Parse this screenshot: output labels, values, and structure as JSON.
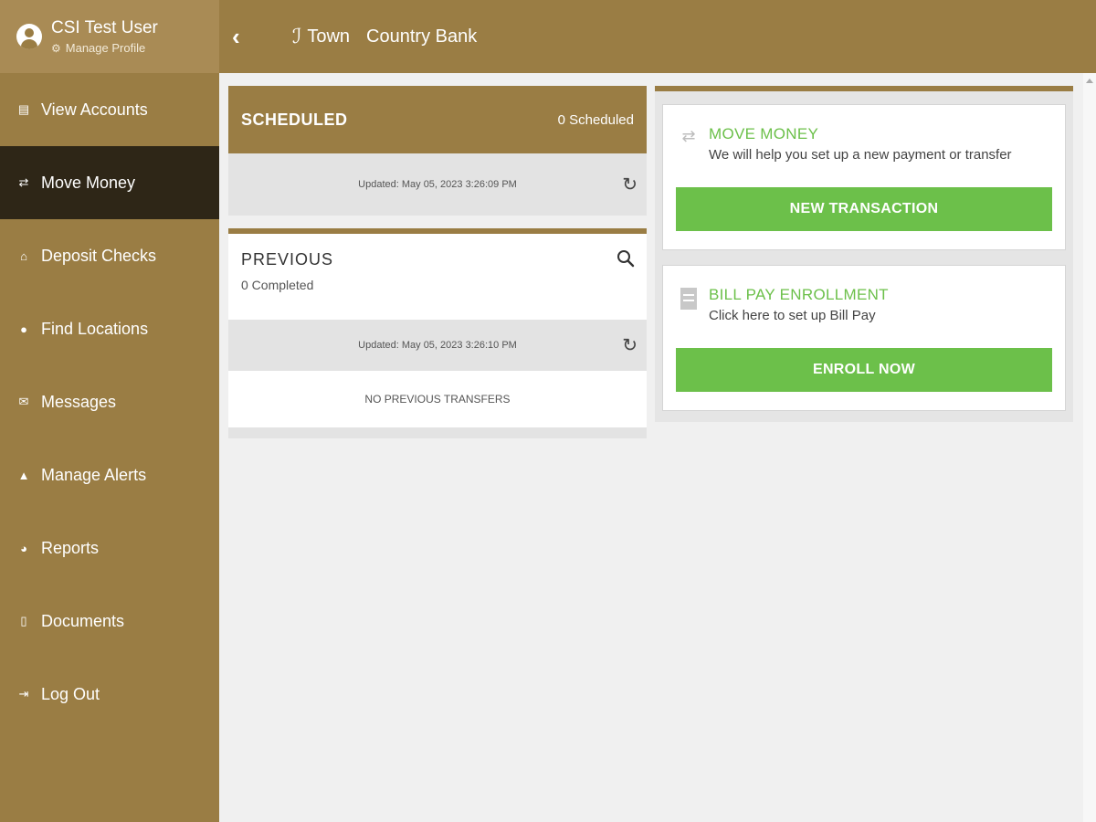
{
  "profile": {
    "name": "CSI Test User",
    "manage_label": "Manage Profile"
  },
  "sidebar": {
    "items": [
      {
        "label": "View Accounts",
        "icon": "accounts-icon"
      },
      {
        "label": "Move Money",
        "icon": "money-transfer-icon",
        "active": true
      },
      {
        "label": "Deposit Checks",
        "icon": "bank-icon"
      },
      {
        "label": "Find Locations",
        "icon": "location-pin-icon"
      },
      {
        "label": "Messages",
        "icon": "envelope-icon"
      },
      {
        "label": "Manage Alerts",
        "icon": "bell-icon"
      },
      {
        "label": "Reports",
        "icon": "pie-chart-icon"
      },
      {
        "label": "Documents",
        "icon": "document-icon"
      },
      {
        "label": "Log Out",
        "icon": "logout-icon"
      }
    ]
  },
  "header": {
    "brand_part1": "Town",
    "brand_part2": "Country Bank"
  },
  "scheduled": {
    "title": "SCHEDULED",
    "count_label": "0 Scheduled",
    "updated": "Updated: May 05, 2023 3:26:09 PM"
  },
  "previous": {
    "title": "PREVIOUS",
    "count_label": "0 Completed",
    "updated": "Updated: May 05, 2023 3:26:10 PM",
    "empty_message": "NO PREVIOUS TRANSFERS"
  },
  "move_money": {
    "title": "MOVE MONEY",
    "description": "We will help you set up a new payment or transfer",
    "button": "NEW TRANSACTION"
  },
  "bill_pay": {
    "title": "BILL PAY ENROLLMENT",
    "description": "Click here to set up Bill Pay",
    "button": "ENROLL NOW"
  },
  "colors": {
    "brand": "#9a7d44",
    "active_nav": "#2e2617",
    "accent_green": "#6cc04a",
    "background": "#f0f0f0"
  }
}
